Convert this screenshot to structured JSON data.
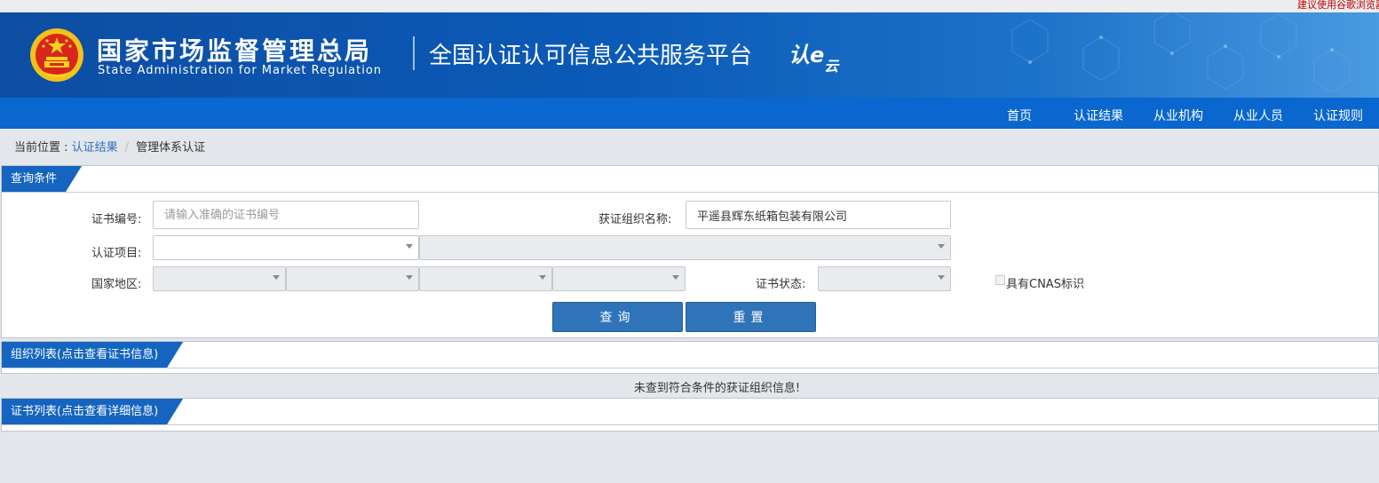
{
  "top_notice": "建议使用谷歌浏览器",
  "header": {
    "org_name_cn": "国家市场监督管理总局",
    "org_name_en": "State Administration for Market Regulation",
    "platform_title": "全国认证认可信息公共服务平台",
    "platform_logo": {
      "main": "认e",
      "sub": "云"
    }
  },
  "nav": {
    "items": [
      {
        "label": "首页"
      },
      {
        "label": "认证结果"
      },
      {
        "label": "从业机构"
      },
      {
        "label": "从业人员"
      },
      {
        "label": "认证规则"
      }
    ]
  },
  "breadcrumb": {
    "prefix": "当前位置 : ",
    "link": "认证结果",
    "separator": "/",
    "current": "管理体系认证"
  },
  "query_panel": {
    "title": "查询条件",
    "cert_no": {
      "label": "证书编号:",
      "value": "",
      "placeholder": "请输入准确的证书编号"
    },
    "org_name": {
      "label": "获证组织名称:",
      "value": "平遥县辉东纸箱包装有限公司"
    },
    "cert_project": {
      "label": "认证项目:",
      "selected": "",
      "secondary_selected": ""
    },
    "region": {
      "label": "国家地区:",
      "selects": [
        "",
        "",
        "",
        ""
      ]
    },
    "cert_status": {
      "label": "证书状态:",
      "selected": ""
    },
    "cnas": {
      "label": "具有CNAS标识",
      "checked": false
    },
    "search_button": "查询",
    "reset_button": "重置"
  },
  "org_list_panel": {
    "title": "组织列表(点击查看证书信息)",
    "empty_message": "未查到符合条件的获证组织信息!"
  },
  "cert_list_panel": {
    "title": "证书列表(点击查看详细信息)"
  },
  "colors": {
    "header_blue": "#0b5ab8",
    "nav_blue": "#0a67cf",
    "tab_blue": "#1565c0",
    "button_blue": "#2f73b8",
    "notice_red": "#c00000"
  }
}
